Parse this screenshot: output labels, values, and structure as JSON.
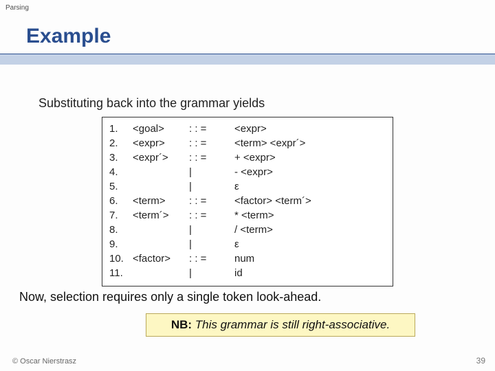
{
  "topic": "Parsing",
  "title": "Example",
  "lead": "Substituting back into the grammar yields",
  "grammar": [
    {
      "num": "1.",
      "lhs": "<goal>",
      "op": ": : =",
      "rhs": "<expr>"
    },
    {
      "num": "2.",
      "lhs": "<expr>",
      "op": ": : =",
      "rhs": "<term> <expr´>"
    },
    {
      "num": "3.",
      "lhs": "<expr´>",
      "op": ": : =",
      "rhs": "+ <expr>"
    },
    {
      "num": "4.",
      "lhs": "",
      "op": "|",
      "rhs": "- <expr>"
    },
    {
      "num": "5.",
      "lhs": "",
      "op": "|",
      "rhs": "ε"
    },
    {
      "num": "6.",
      "lhs": "<term>",
      "op": ": : =",
      "rhs": "<factor> <term´>"
    },
    {
      "num": "7.",
      "lhs": "<term´>",
      "op": ": : =",
      "rhs": "* <term>"
    },
    {
      "num": "8.",
      "lhs": "",
      "op": "|",
      "rhs": "/ <term>"
    },
    {
      "num": "9.",
      "lhs": "",
      "op": "|",
      "rhs": "ε"
    },
    {
      "num": "10.",
      "lhs": "<factor>",
      "op": ": : =",
      "rhs": "num"
    },
    {
      "num": "11.",
      "lhs": "",
      "op": "|",
      "rhs": "id"
    }
  ],
  "conclusion": "Now, selection requires only a single token look-ahead.",
  "callout_nb": "NB:",
  "callout_text": " This grammar is still right-associative.",
  "copyright": "© Oscar Nierstrasz",
  "pagenum": "39"
}
